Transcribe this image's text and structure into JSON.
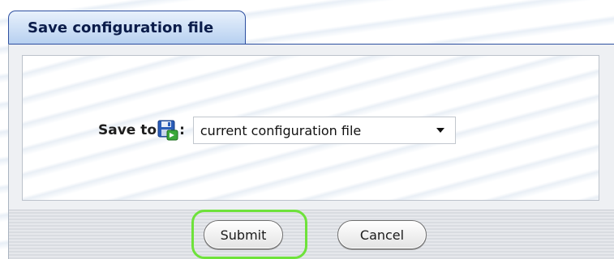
{
  "dialog": {
    "title": "Save configuration file"
  },
  "form": {
    "save_label": "Save to",
    "colon": ":",
    "save_icon": "floppy-disk-icon",
    "destination_select": {
      "selected": "current configuration file"
    }
  },
  "footer": {
    "submit_label": "Submit",
    "cancel_label": "Cancel"
  },
  "colors": {
    "title_tab_border": "#2d4fa0",
    "highlight_ring": "#6ee23b",
    "panel_background": "#eef0f3"
  }
}
